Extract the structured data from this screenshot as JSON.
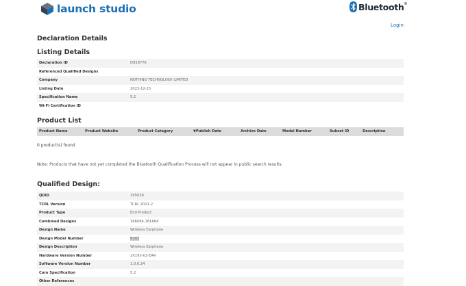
{
  "brand": {
    "logo_text": "launch studio",
    "bt_text": "Bluetooth",
    "bt_mark": "®"
  },
  "login": "Login",
  "page_title": "Declaration Details",
  "listing": {
    "title": "Listing Details",
    "rows": [
      {
        "label": "Declaration ID",
        "value": "D058776"
      },
      {
        "label": "Referenced Qualified Designs",
        "value": ""
      },
      {
        "label": "Company",
        "value": "NOTHING TECHNOLOGY LIMITED"
      },
      {
        "label": "Listing Date",
        "value": "2022-12-15"
      },
      {
        "label": "Specification Name",
        "value": "5.2"
      },
      {
        "label": "Wi-Fi Certification ID",
        "value": ""
      }
    ]
  },
  "products": {
    "title": "Product List",
    "columns": [
      "Product Name",
      "Product Website",
      "Product Category",
      "Publish Date",
      "Archive Date",
      "Model Number",
      "Subset ID",
      "Description"
    ],
    "sort_arrow": "▼",
    "found": "0 product(s) found",
    "note": "Note: Products that have not yet completed the Bluetooth Qualification Process will not appear in public search results."
  },
  "qualified": {
    "title": "Qualified Design:",
    "rows": [
      {
        "label": "QDID",
        "value": "195039"
      },
      {
        "label": "TCRL Version",
        "value": "TCRL 2021-2"
      },
      {
        "label": "Product Type",
        "value": "End Product"
      },
      {
        "label": "Combined Designs",
        "value": "166084,181664"
      },
      {
        "label": "Design Name",
        "value": "Wireless Earphone"
      },
      {
        "label": "Design Model Number",
        "value": "B163"
      },
      {
        "label": "Design Description",
        "value": "Wireless Earphone"
      },
      {
        "label": "Hardware Version Number",
        "value": "2X195-02-EAR"
      },
      {
        "label": "Software Version Number",
        "value": "1.0.0.24"
      },
      {
        "label": "Core Specification",
        "value": "5.2"
      },
      {
        "label": "Other References",
        "value": ""
      }
    ]
  }
}
